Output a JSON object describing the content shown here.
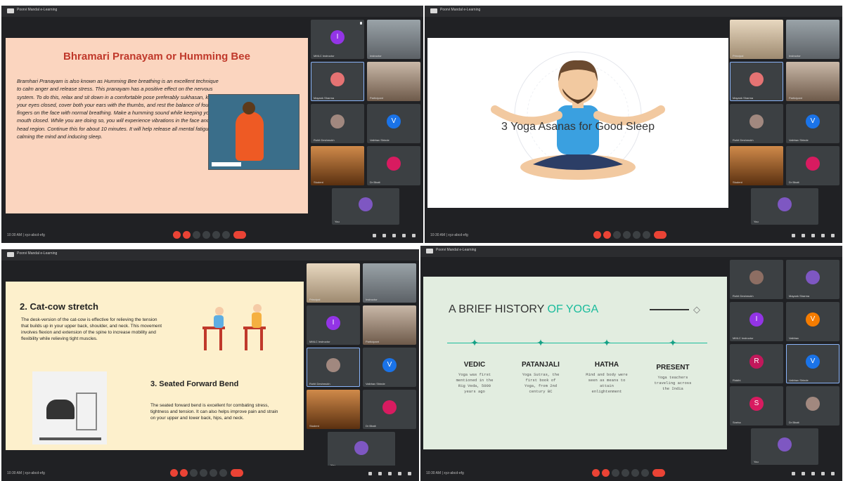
{
  "meeting_title": "Poorvi Mandal e-Learning",
  "clock_label": "10:30 AM | xyz-abcd-efg",
  "panels": {
    "p1": {
      "title": "Bhramari Pranayam or Humming Bee",
      "body": "Bramhari Pranayam is also known as Humming Bee breathing is an excellent technique to calm anger and release stress. This pranayam has a positive effect on the nervous system. To do this, relax and sit down in a comfortable pose preferably sukhasan, keep your eyes closed, cover both your ears with the thumbs, and rest the balance of four fingers on the face with normal breathing. Make a humming sound while keeping your mouth closed. While you are doing so, you will experience vibrations in the face and head region. Continue this for about 10 minutes. It will help release all mental fatigue, calming the mind and inducing sleep.",
      "tiles": [
        {
          "name": "MMLC Instructor",
          "initial": "I",
          "color": "#9334e6"
        },
        {
          "name": "Instructor"
        },
        {
          "name": "Mayank Sharma"
        },
        {
          "name": "Participant"
        },
        {
          "name": "Rohit Deshmukh"
        },
        {
          "name": "Vaibhav Shinde",
          "initial": "V",
          "color": "#1a73e8"
        },
        {
          "name": "Student"
        },
        {
          "name": "Dr Bhatt"
        },
        {
          "name": "You"
        }
      ]
    },
    "p2": {
      "title": "3 Yoga Asanas for Good Sleep",
      "tiles": [
        {
          "name": "Principal"
        },
        {
          "name": "Instructor"
        },
        {
          "name": "Mayank Sharma"
        },
        {
          "name": "Participant"
        },
        {
          "name": "Rohit Deshmukh"
        },
        {
          "name": "Vaibhav Shinde",
          "initial": "V",
          "color": "#1a73e8"
        },
        {
          "name": "Student"
        },
        {
          "name": "Dr Bhatt"
        },
        {
          "name": "You"
        }
      ]
    },
    "p3": {
      "heading1": "2. Cat-cow stretch",
      "text1": "The desk-version of the cat-cow is effective for relieving the tension that builds up in your upper back, shoulder, and neck. This movement involves flexion and extension of the spine to increase mobility and flexibility while relieving tight muscles.",
      "heading2": "3. Seated Forward Bend",
      "text2": "The seated forward bend is excellent for combating stress, tightness and tension. It can also helps improve pain and strain on your upper and lower back, hips, and neck.",
      "tiles": [
        {
          "name": "Principal"
        },
        {
          "name": "Instructor"
        },
        {
          "name": "MMLC Instructor",
          "initial": "I",
          "color": "#9334e6"
        },
        {
          "name": "Participant"
        },
        {
          "name": "Rohit Deshmukh"
        },
        {
          "name": "Vaibhav Shinde",
          "initial": "V",
          "color": "#1a73e8"
        },
        {
          "name": "Student"
        },
        {
          "name": "Dr Bhatt"
        },
        {
          "name": "You"
        }
      ]
    },
    "p4": {
      "title_a": "A BRIEF HISTORY ",
      "title_b": "OF YOGA",
      "eras": [
        {
          "name": "VEDIC",
          "desc": "Yoga was first mentioned in the Rig Veda, 5000 years ago"
        },
        {
          "name": "PATANJALI",
          "desc": "Yoga Sutras, the first book of Yoga, from 2nd century BC"
        },
        {
          "name": "HATHA",
          "desc": "Mind and body were seen as means to attain enlightenment"
        },
        {
          "name": "PRESENT",
          "desc": "Yoga teachers traveling across the India"
        }
      ],
      "tiles": [
        {
          "name": "Rohit Deshmukh"
        },
        {
          "name": "Mayank Sharma"
        },
        {
          "name": "MMLC Instructor",
          "initial": "I",
          "color": "#9334e6"
        },
        {
          "name": "Vaibhav",
          "initial": "V",
          "color": "#f57c00"
        },
        {
          "name": "Riddhi",
          "initial": "R",
          "color": "#c2185b"
        },
        {
          "name": "Vaibhav Shinde",
          "initial": "V",
          "color": "#1a73e8"
        },
        {
          "name": "Sneha",
          "initial": "S",
          "color": "#d81b60"
        },
        {
          "name": "Dr Bhatt"
        },
        {
          "name": "You"
        }
      ]
    }
  }
}
